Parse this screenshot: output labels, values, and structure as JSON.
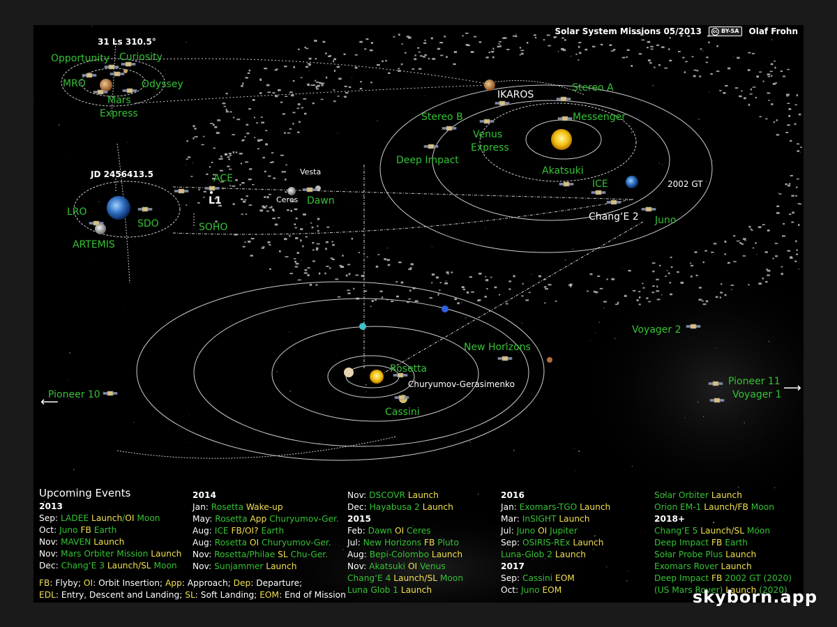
{
  "header": {
    "title": "Solar System Missions 05/2013",
    "license": "BY-SA",
    "author": "Olaf Frohn"
  },
  "mars_panel": {
    "date": "31 Ls 310.5°",
    "labels": [
      "Opportunity",
      "Curiosity",
      "MRO",
      "Odyssey",
      "Mars",
      "Express"
    ]
  },
  "earth_panel": {
    "date": "JD 2456413.5",
    "labels": [
      "ACE",
      "L1",
      "LRO",
      "SDO",
      "SOHO",
      "ARTEMIS"
    ]
  },
  "inner_labels": {
    "ikaros": "IKAROS",
    "stereo_a": "Stereo A",
    "stereo_b": "Stereo B",
    "messenger": "Messenger",
    "venus_express_1": "Venus",
    "venus_express_2": "Express",
    "deep_impact": "Deep Impact",
    "akatsuki": "Akatsuki",
    "ice": "ICE",
    "gt2002": "2002 GT",
    "change2": "Chang‘E 2",
    "juno": "Juno",
    "vesta": "Vesta",
    "ceres": "Ceres",
    "dawn": "Dawn"
  },
  "outer_labels": {
    "new_horizons": "New Horizons",
    "rosetta": "Rosetta",
    "churyumov": "Churyumov-Gerasimenko",
    "cassini": "Cassini",
    "voyager2": "Voyager 2",
    "pioneer11": "Pioneer 11",
    "voyager1": "Voyager 1",
    "pioneer10": "Pioneer 10"
  },
  "events_title": "Upcoming Events",
  "columns": [
    [
      {
        "year": "2013"
      },
      {
        "m": "Sep: ",
        "parts": [
          [
            "a",
            "LADEE "
          ],
          [
            "b",
            "Launch"
          ],
          [
            "a",
            "/"
          ],
          [
            "b",
            "OI "
          ],
          [
            "a",
            "Moon"
          ]
        ]
      },
      {
        "m": "Oct: ",
        "parts": [
          [
            "a",
            "Juno "
          ],
          [
            "b",
            "FB "
          ],
          [
            "a",
            "Earth"
          ]
        ]
      },
      {
        "m": "Nov: ",
        "parts": [
          [
            "a",
            "MAVEN "
          ],
          [
            "b",
            "Launch"
          ]
        ]
      },
      {
        "m": "Nov: ",
        "parts": [
          [
            "a",
            "Mars Orbiter Mission "
          ],
          [
            "b",
            "Launch"
          ]
        ]
      },
      {
        "m": "Dec: ",
        "parts": [
          [
            "a",
            "Chang‘E 3 "
          ],
          [
            "b",
            "Launch/SL "
          ],
          [
            "a",
            "Moon"
          ]
        ]
      }
    ],
    [
      {
        "year": "2014"
      },
      {
        "m": "Jan: ",
        "parts": [
          [
            "a",
            "Rosetta "
          ],
          [
            "b",
            "Wake-up"
          ]
        ]
      },
      {
        "m": "May: ",
        "parts": [
          [
            "a",
            "Rosetta "
          ],
          [
            "b",
            "App "
          ],
          [
            "a",
            "Churyumov-Ger."
          ]
        ]
      },
      {
        "m": "Aug: ",
        "parts": [
          [
            "a",
            "ICE "
          ],
          [
            "b",
            "FB/OI? "
          ],
          [
            "a",
            "Earth"
          ]
        ]
      },
      {
        "m": "Aug: ",
        "parts": [
          [
            "a",
            "Rosetta "
          ],
          [
            "b",
            "OI "
          ],
          [
            "a",
            "Churyumov-Ger."
          ]
        ]
      },
      {
        "m": "Nov: ",
        "parts": [
          [
            "a",
            "Rosetta/Philae "
          ],
          [
            "b",
            "SL "
          ],
          [
            "a",
            "Chu-Ger."
          ]
        ]
      },
      {
        "m": "Nov: ",
        "parts": [
          [
            "a",
            "Sunjammer "
          ],
          [
            "b",
            "Launch"
          ]
        ]
      }
    ],
    [
      {
        "m": "Nov: ",
        "parts": [
          [
            "a",
            "DSCOVR "
          ],
          [
            "b",
            "Launch"
          ]
        ]
      },
      {
        "m": "Dec: ",
        "parts": [
          [
            "a",
            "Hayabusa 2 "
          ],
          [
            "b",
            "Launch"
          ]
        ]
      },
      {
        "year": "2015"
      },
      {
        "m": "Feb: ",
        "parts": [
          [
            "a",
            "Dawn "
          ],
          [
            "b",
            "OI "
          ],
          [
            "a",
            "Ceres"
          ]
        ]
      },
      {
        "m": "Jul: ",
        "parts": [
          [
            "a",
            " New Horizons "
          ],
          [
            "b",
            "FB "
          ],
          [
            "a",
            "Pluto"
          ]
        ]
      },
      {
        "m": "Aug: ",
        "parts": [
          [
            "a",
            "Bepi-Colombo "
          ],
          [
            "b",
            "Launch"
          ]
        ]
      },
      {
        "m": "Nov: ",
        "parts": [
          [
            "a",
            "Akatsuki "
          ],
          [
            "b",
            "OI "
          ],
          [
            "a",
            "Venus"
          ]
        ]
      },
      {
        "m": "",
        "parts": [
          [
            "a",
            "Chang‘E 4 "
          ],
          [
            "b",
            "Launch/SL "
          ],
          [
            "a",
            "Moon"
          ]
        ]
      },
      {
        "m": "",
        "parts": [
          [
            "a",
            "Luna Glob 1 "
          ],
          [
            "b",
            "Launch"
          ]
        ]
      }
    ],
    [
      {
        "year": "2016"
      },
      {
        "m": "Jan: ",
        "parts": [
          [
            "a",
            "Exomars-TGO "
          ],
          [
            "b",
            "Launch"
          ]
        ]
      },
      {
        "m": "Mar: ",
        "parts": [
          [
            "a",
            "InSIGHT "
          ],
          [
            "b",
            "Launch"
          ]
        ]
      },
      {
        "m": "Jul: ",
        "parts": [
          [
            "a",
            "Juno "
          ],
          [
            "b",
            "OI "
          ],
          [
            "a",
            "Jupiter"
          ]
        ]
      },
      {
        "m": "Sep: ",
        "parts": [
          [
            "a",
            "OSIRIS-REx "
          ],
          [
            "b",
            "Launch"
          ]
        ]
      },
      {
        "m": "",
        "parts": [
          [
            "a",
            "Luna-Glob 2 "
          ],
          [
            "b",
            "Launch"
          ]
        ]
      },
      {
        "year": "2017"
      },
      {
        "m": "Sep: ",
        "parts": [
          [
            "a",
            "Cassini "
          ],
          [
            "b",
            "EOM"
          ]
        ]
      },
      {
        "m": "Oct: ",
        "parts": [
          [
            "a",
            "Juno "
          ],
          [
            "b",
            "EOM"
          ]
        ]
      }
    ],
    [
      {
        "m": "",
        "parts": [
          [
            "a",
            "Solar Orbiter "
          ],
          [
            "b",
            "Launch"
          ]
        ]
      },
      {
        "m": "",
        "parts": [
          [
            "a",
            "Orion EM-1 "
          ],
          [
            "b",
            "Launch/FB "
          ],
          [
            "a",
            "Moon"
          ]
        ]
      },
      {
        "year": "2018+"
      },
      {
        "m": "",
        "parts": [
          [
            "a",
            "Chang‘E 5 "
          ],
          [
            "b",
            "Launch/SL "
          ],
          [
            "a",
            "Moon"
          ]
        ]
      },
      {
        "m": "",
        "parts": [
          [
            "a",
            "Deep Impact "
          ],
          [
            "b",
            "FB "
          ],
          [
            "a",
            "Earth"
          ]
        ]
      },
      {
        "m": "",
        "parts": [
          [
            "a",
            "Solar Probe Plus "
          ],
          [
            "b",
            "Launch"
          ]
        ]
      },
      {
        "m": "",
        "parts": [
          [
            "a",
            "Exomars Rover "
          ],
          [
            "b",
            "Launch"
          ]
        ]
      },
      {
        "m": "",
        "parts": [
          [
            "a",
            "Deep Impact "
          ],
          [
            "b",
            "FB "
          ],
          [
            "a",
            "2002 GT (2020)"
          ]
        ]
      },
      {
        "m": "",
        "parts": [
          [
            "a",
            "(US Mars Rover) "
          ],
          [
            "b",
            "Launch "
          ],
          [
            "a",
            "(2020)"
          ]
        ]
      }
    ]
  ],
  "legend": [
    [
      [
        "ab",
        "FB"
      ],
      [
        "tx",
        ": Flyby; "
      ],
      [
        "ab",
        "OI"
      ],
      [
        "tx",
        ": Orbit Insertion; "
      ],
      [
        "ab",
        "App"
      ],
      [
        "tx",
        ": Approach; "
      ],
      [
        "ab",
        "Dep"
      ],
      [
        "tx",
        ": Departure;"
      ]
    ],
    [
      [
        "ab",
        "EDL"
      ],
      [
        "tx",
        ": Entry, Descent and Landing; "
      ],
      [
        "ab",
        "SL"
      ],
      [
        "tx",
        ": Soft Landing; "
      ],
      [
        "ab",
        "EOM"
      ],
      [
        "tx",
        ": End of Mission"
      ]
    ]
  ],
  "watermark": "skyborn.app",
  "colors": {
    "mission": "#35c235",
    "event": "#f0e050",
    "text": "#ffffff",
    "background": "#000000"
  }
}
